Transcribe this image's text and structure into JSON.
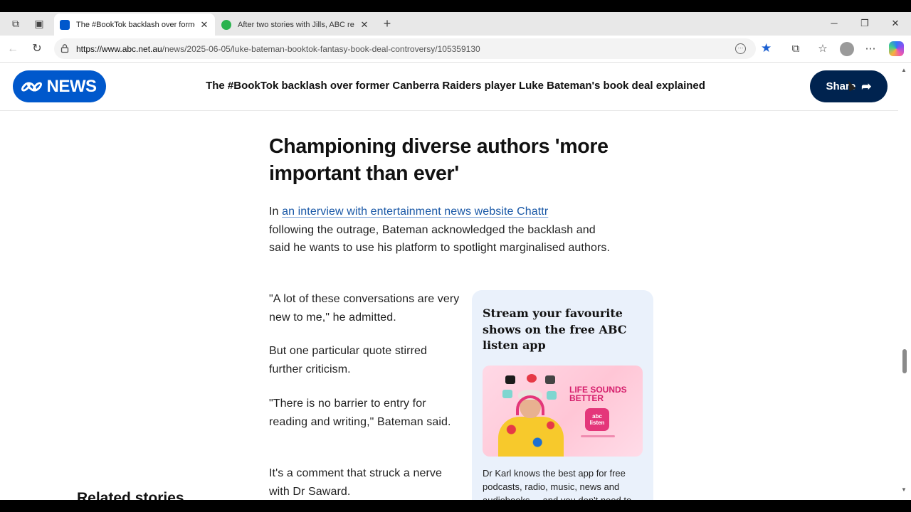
{
  "browser": {
    "tabs": [
      {
        "title": "The #BookTok backlash over former Canberra Raiders player",
        "active": true,
        "favicon_color": "#0058cc"
      },
      {
        "title": "After two stories with Jills, ABC re",
        "active": false,
        "favicon_color": "#2bb34f"
      }
    ],
    "tab_close": "✕",
    "new_tab": "+",
    "window_controls": {
      "minimize": "─",
      "restore": "❐",
      "close": "✕"
    },
    "url_domain": "https://www.abc.net.au",
    "url_path": "/news/2025-06-05/luke-bateman-booktok-fantasy-book-deal-controversy/105359130",
    "nav": {
      "back": "←",
      "reload": "↻"
    },
    "toolbar_icons": [
      "star-filled-icon",
      "extensions-icon",
      "favorites-icon",
      "profile-icon",
      "more-icon",
      "copilot-icon"
    ],
    "more": "⋯"
  },
  "header": {
    "logo_text": "NEWS",
    "article_title": "The #BookTok backlash over former Canberra Raiders player Luke Bateman's book deal explained",
    "share_label": "Share",
    "share_icon": "➦"
  },
  "article": {
    "heading": "Championing diverse authors 'more important than ever'",
    "p1_prefix": "In ",
    "p1_link": "an interview with entertainment news website Chattr",
    "p1_rest": "following the outrage, Bateman acknowledged the backlash and said he wants to use his platform to spotlight marginalised authors.",
    "p2": "\"A lot of these conversations are very new to me,\" he admitted.",
    "p3": "But one particular quote stirred further criticism.",
    "p4": "\"There is no barrier to entry for reading and writing,\" Bateman said.",
    "p5": "It's a comment that struck a nerve with Dr Saward."
  },
  "promo": {
    "title": "Stream your favourite shows on the free ABC listen app",
    "image_tagline": "LIFE SOUNDS BETTER",
    "app_label": "listen",
    "body": "Dr Karl knows the best app for free podcasts, radio, music, news and audiobooks ... and you don't need to"
  },
  "related_heading": "Related stories",
  "colors": {
    "abc_blue": "#0058cc",
    "share_navy": "#00234f",
    "link": "#1857a6",
    "promo_bg": "#eaf1fb"
  }
}
